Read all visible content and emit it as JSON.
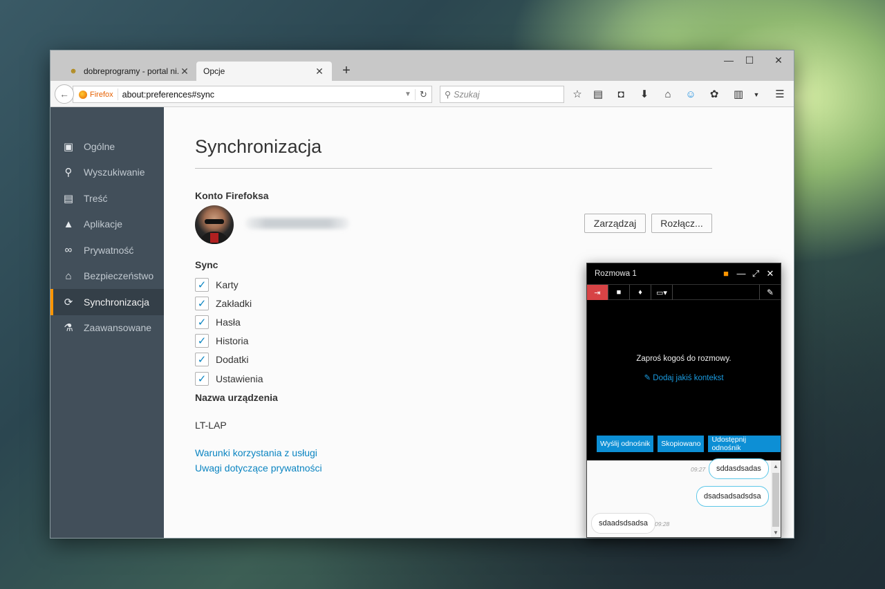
{
  "tabs": [
    {
      "label": "dobreprogramy - portal ni...",
      "active": false
    },
    {
      "label": "Opcje",
      "active": true
    }
  ],
  "navbar": {
    "identity": "Firefox",
    "url": "about:preferences#sync",
    "search_placeholder": "Szukaj"
  },
  "sidebar": {
    "items": [
      {
        "label": "Ogólne",
        "icon": "general-icon"
      },
      {
        "label": "Wyszukiwanie",
        "icon": "search-icon"
      },
      {
        "label": "Treść",
        "icon": "content-icon"
      },
      {
        "label": "Aplikacje",
        "icon": "applications-icon"
      },
      {
        "label": "Prywatność",
        "icon": "privacy-mask-icon"
      },
      {
        "label": "Bezpieczeństwo",
        "icon": "security-icon"
      },
      {
        "label": "Synchronizacja",
        "icon": "sync-icon",
        "active": true
      },
      {
        "label": "Zaawansowane",
        "icon": "advanced-icon"
      }
    ]
  },
  "main": {
    "title": "Synchronizacja",
    "account_heading": "Konto Firefoksa",
    "manage_label": "Zarządzaj",
    "disconnect_label": "Rozłącz...",
    "sync_heading": "Sync",
    "sync_items": [
      {
        "label": "Karty",
        "checked": true
      },
      {
        "label": "Zakładki",
        "checked": true
      },
      {
        "label": "Hasła",
        "checked": true
      },
      {
        "label": "Historia",
        "checked": true
      },
      {
        "label": "Dodatki",
        "checked": true
      },
      {
        "label": "Ustawienia",
        "checked": true
      }
    ],
    "device_heading": "Nazwa urządzenia",
    "device_name": "LT-LAP",
    "links": [
      "Warunki korzystania z usługi",
      "Uwagi dotyczące prywatności"
    ]
  },
  "chat": {
    "title": "Rozmowa 1",
    "invite_text": "Zaproś kogoś do rozmowy.",
    "context_link": "Dodaj jakiś kontekst",
    "actions": [
      "Wyślij odnośnik",
      "Skopiowano",
      "Udostępnij odnośnik"
    ],
    "messages": [
      {
        "text": "sddasdsadas",
        "time": "09:27",
        "side": "right"
      },
      {
        "text": "dsadsadsadsdsa",
        "time": "",
        "side": "right"
      },
      {
        "text": "sdaadsdsadsa",
        "time": "09:28",
        "side": "left"
      }
    ]
  },
  "colors": {
    "accent_orange": "#ff9500",
    "link_blue": "#0a84c1",
    "sidebar_bg": "#424f5a",
    "chat_red": "#d74345",
    "chat_button": "#0d8fd5"
  }
}
